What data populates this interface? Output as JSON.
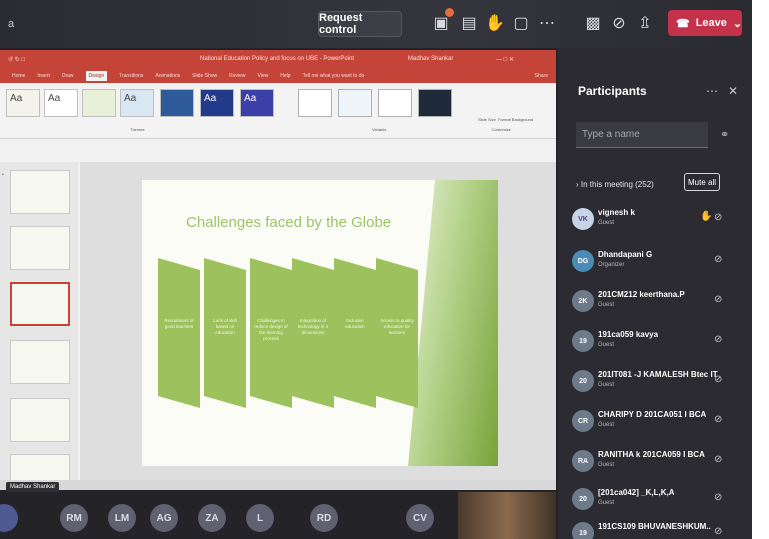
{
  "toolbar": {
    "title_fragment": "a",
    "request_control": "Request control",
    "leave": "Leave",
    "icons": [
      "chat-icon",
      "participants-icon",
      "raise-hand-icon",
      "rooms-icon",
      "more-icon",
      "camera-off-icon",
      "mic-off-icon",
      "share-icon"
    ]
  },
  "ppt": {
    "title": "National Education Policy and focus on UBE - PowerPoint",
    "user": "Madhav Shankar",
    "tabs": [
      "Home",
      "Insert",
      "Draw",
      "Design",
      "Transitions",
      "Animations",
      "Slide Show",
      "Review",
      "View",
      "Help",
      "Tell me what you want to do"
    ],
    "active_tab": "Design",
    "share": "Share",
    "themes_label": "Themes",
    "variants_label": "Variants",
    "customize_label": "Customize",
    "slide_size": "Slide Size",
    "format_bg": "Format Background",
    "slide_title": "Challenges faced by the Globe",
    "chevrons": [
      "Recruitment of good teachers",
      "Lack of skill based on education",
      "Challenges to reduce design of the learning process",
      "Integration of technology in 4 dimensions",
      "Inclusive education",
      "Access to quality education for learners"
    ],
    "presenter": "Madhav Shankar"
  },
  "avatars": [
    "RM",
    "LM",
    "AG",
    "ZA",
    "L",
    "RD",
    "CV"
  ],
  "panel": {
    "title": "Participants",
    "search_placeholder": "Type a name",
    "in_meeting": "In this meeting (252)",
    "mute_all": "Mute all",
    "participants": [
      {
        "initials": "VK",
        "name": "vignesh k",
        "role": "Guest",
        "hand": true
      },
      {
        "initials": "DG",
        "name": "Dhandapani G",
        "role": "Organizer",
        "hand": false
      },
      {
        "initials": "2K",
        "name": "201CM212 keerthana.P",
        "role": "Guest",
        "hand": false
      },
      {
        "initials": "19",
        "name": "191ca059 kavya",
        "role": "Guest",
        "hand": false
      },
      {
        "initials": "20",
        "name": "201IT081 -J KAMALESH Btec IT",
        "role": "Guest",
        "hand": false
      },
      {
        "initials": "CR",
        "name": "CHARIPY D 201CA051 I BCA",
        "role": "Guest",
        "hand": false
      },
      {
        "initials": "RA",
        "name": "RANITHA k 201CA059 I BCA",
        "role": "Guest",
        "hand": false
      },
      {
        "initials": "20",
        "name": "[201ca042] _K,L,K,A",
        "role": "Guest",
        "hand": false
      },
      {
        "initials": "19",
        "name": "191CS109 BHUVANESHKUM..",
        "role": "Guest",
        "hand": false
      }
    ]
  }
}
